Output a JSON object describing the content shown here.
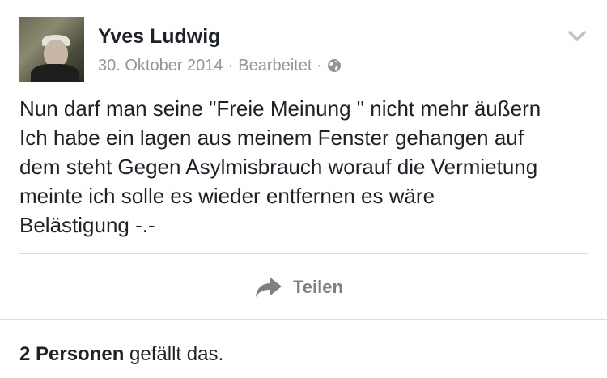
{
  "post": {
    "author": "Yves Ludwig",
    "date": "30. Oktober 2014",
    "edited_label": "Bearbeitet",
    "separator": "·",
    "privacy_icon": "globe-icon",
    "menu_icon": "chevron-down-icon",
    "text_lines": [
      "Nun darf man seine \"Freie Meinung \" nicht mehr äußern",
      "Ich habe ein lagen aus meinem Fenster gehangen auf",
      "dem steht Gegen Asylmisbrauch worauf die Vermietung",
      "meinte ich solle es wieder entfernen es wäre",
      "Belästigung -.-"
    ]
  },
  "actions": {
    "share_label": "Teilen",
    "share_icon": "share-arrow-icon"
  },
  "likes": {
    "count_label": "2 Personen",
    "suffix": " gefällt das."
  },
  "colors": {
    "text": "#1d2129",
    "meta": "#90949c",
    "action": "#7f7f7f",
    "divider": "#dadde1"
  }
}
